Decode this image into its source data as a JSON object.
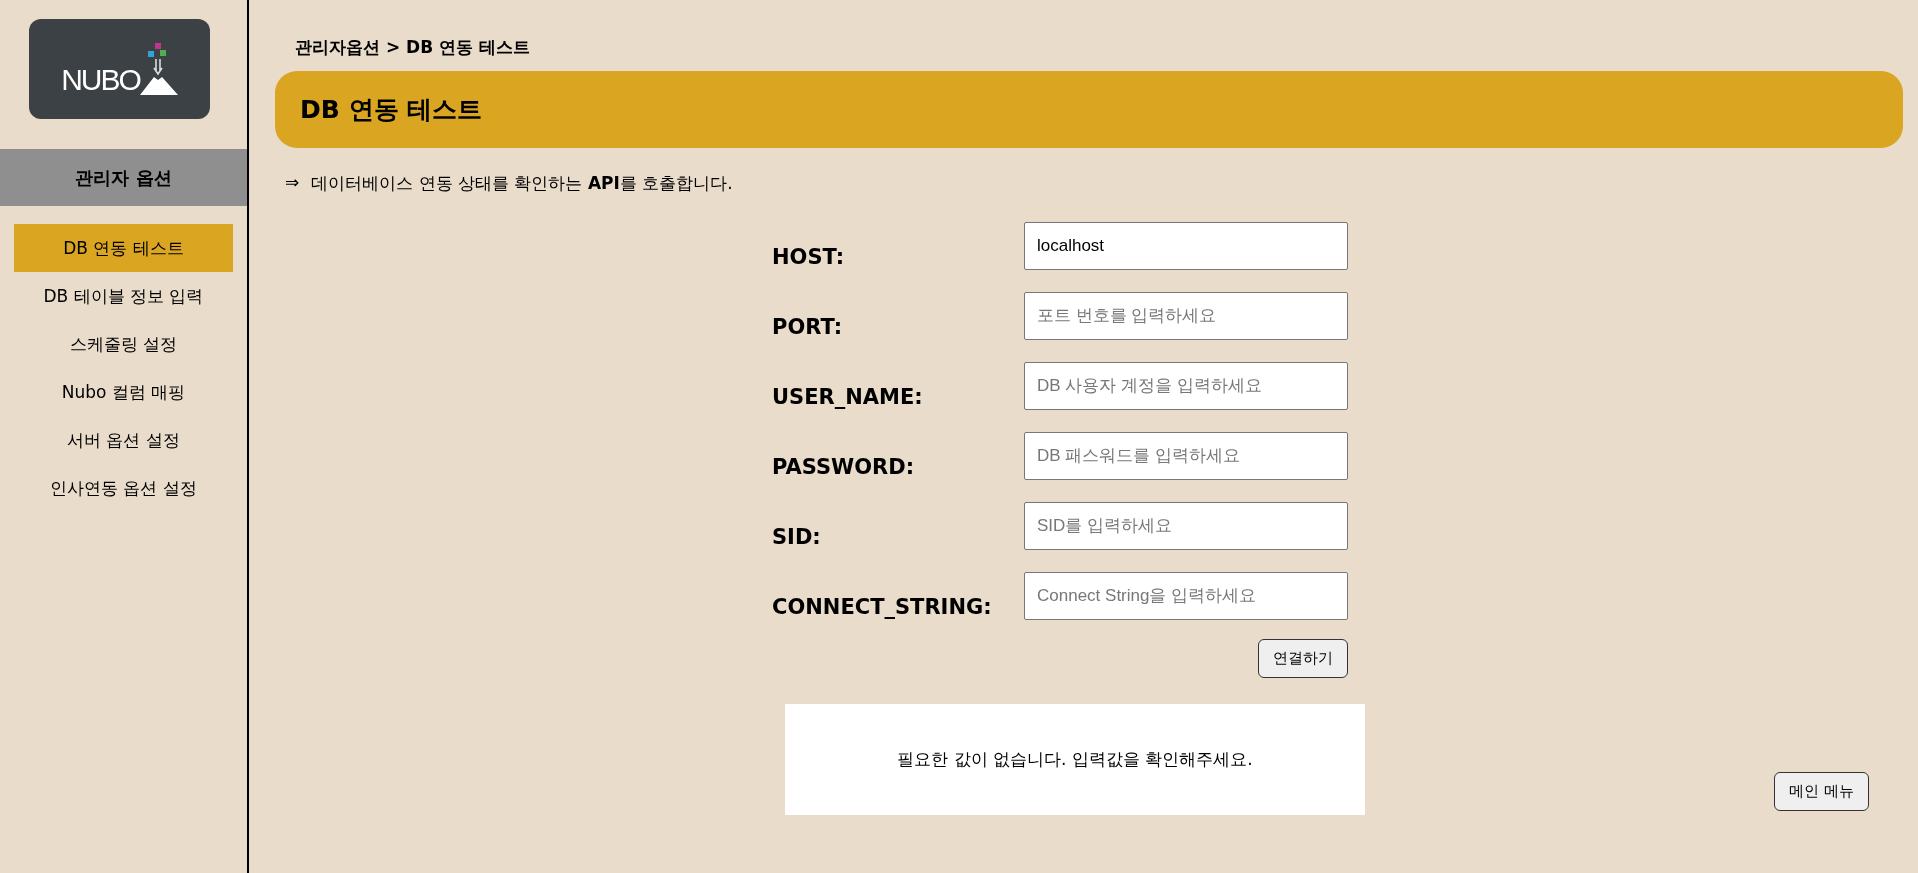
{
  "sidebar": {
    "logo": {
      "text": "NUBO"
    },
    "section_title": "관리자 옵션",
    "items": [
      {
        "label": "DB 연동 테스트",
        "selected": true
      },
      {
        "label": "DB 테이블 정보 입력",
        "selected": false
      },
      {
        "label": "스케줄링 설정",
        "selected": false
      },
      {
        "label": "Nubo 컬럼 매핑",
        "selected": false
      },
      {
        "label": "서버 옵션 설정",
        "selected": false
      },
      {
        "label": "인사연동 옵션 설정",
        "selected": false
      }
    ]
  },
  "breadcrumb": "관리자옵션 > DB 연동 테스트",
  "page_title": "DB 연동 테스트",
  "description": {
    "arrow": "⇒",
    "text": "데이터베이스 연동 상태를 확인하는 **API**를 호출합니다."
  },
  "form": {
    "fields": [
      {
        "label": "HOST:",
        "value": "localhost"
      },
      {
        "label": "PORT:",
        "placeholder": "포트 번호를 입력하세요"
      },
      {
        "label": "USER_NAME:",
        "placeholder": "DB 사용자 계정을 입력하세요"
      },
      {
        "label": "PASSWORD:",
        "placeholder": "DB 패스워드를 입력하세요"
      },
      {
        "label": "SID:",
        "placeholder": "SID를 입력하세요"
      },
      {
        "label": "CONNECT_STRING:",
        "placeholder": "Connect String을 입력하세요"
      }
    ],
    "submit_button": "연결하기"
  },
  "message": "필요한 값이 없습니다. 입력값을 확인해주세요.",
  "main_menu_button": "메인 메뉴"
}
